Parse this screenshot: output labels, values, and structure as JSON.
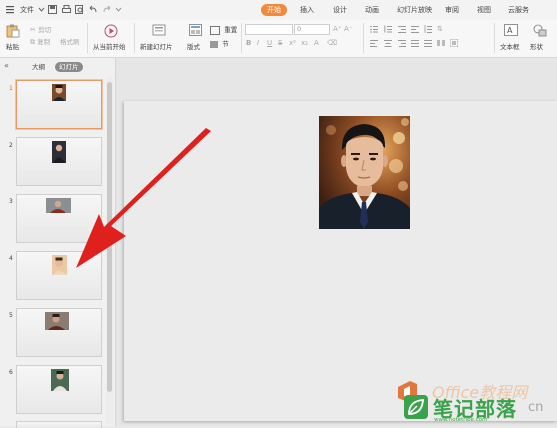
{
  "menubar": {
    "file_label": "文件",
    "tabs": [
      {
        "label": "开始",
        "active": true
      },
      {
        "label": "插入"
      },
      {
        "label": "设计"
      },
      {
        "label": "动画"
      },
      {
        "label": "幻灯片放映"
      },
      {
        "label": "审阅"
      },
      {
        "label": "视图"
      },
      {
        "label": "云服务"
      }
    ]
  },
  "ribbon": {
    "paste": "粘贴",
    "cut": "剪切",
    "copy": "复制",
    "format_painter": "格式刷",
    "play_from_current": "从当前开始",
    "new_slide": "新建幻灯片",
    "layout": "版式",
    "reset": "重置",
    "section": "节",
    "font_size": "0",
    "textbox": "文本框",
    "shape": "形状"
  },
  "left_panel": {
    "tab_outline": "大纲",
    "tab_slides": "幻灯片",
    "slides": [
      {
        "number": "1",
        "selected": true
      },
      {
        "number": "2"
      },
      {
        "number": "3"
      },
      {
        "number": "4"
      },
      {
        "number": "5"
      },
      {
        "number": "6"
      }
    ]
  },
  "watermark": {
    "top_text": "Office教程网",
    "brand": "笔记部落",
    "domain_suffix": "cn",
    "url": "www.notetribe.com"
  },
  "colors": {
    "accent_orange": "#f28a3b",
    "arrow_red": "#e0201c",
    "watermark_green": "#3aa24a"
  }
}
